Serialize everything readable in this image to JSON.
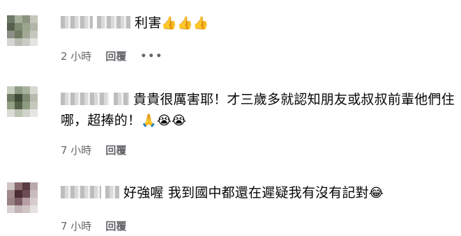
{
  "comments": [
    {
      "text": "利害",
      "emojis": "👍👍👍",
      "time": "2 小時",
      "reply": "回覆",
      "more": "•••",
      "avatar_colors": [
        "#6d7a66",
        "#a7b09c",
        "#8a9480",
        "#c6c6bc",
        "#56604f",
        "#7e8b72",
        "#9aa58c",
        "#b2b6a8",
        "#8b8f86",
        "#6f7b63",
        "#a2a896",
        "#c4c7bd",
        "#d5d6d1",
        "#b9bdb3",
        "#c9cbc4",
        "#e3e3df"
      ]
    },
    {
      "text": "貴貴很厲害耶！才三歲多就認知朋友或叔叔前輩他們住哪，超捧的！",
      "emojis": "🙏😭😭",
      "time": "7 小時",
      "reply": "回覆",
      "avatar_colors": [
        "#c7cfc0",
        "#8f9c83",
        "#a8b19c",
        "#d6d8d0",
        "#6e7a63",
        "#3f4b36",
        "#7d8a70",
        "#b8bcae",
        "#93a082",
        "#556248",
        "#8e9b80",
        "#c5c8bd",
        "#d9dbd5",
        "#bcc2b2",
        "#cfd2c9",
        "#e6e7e3"
      ]
    },
    {
      "text": "好強喔 我到國中都還在遲疑我有沒有記對",
      "emojis": "😂",
      "time": "7 小時",
      "reply": "回覆",
      "avatar_colors": [
        "#d0c6c6",
        "#8a6a6e",
        "#5c3c44",
        "#b9a9aa",
        "#a28a8c",
        "#4a2c34",
        "#6e4c54",
        "#c9bcbc",
        "#9a8284",
        "#7a5c62",
        "#b69ea2",
        "#d7cccc",
        "#d9d2d2",
        "#c3b4b6",
        "#cfc3c4",
        "#e6e1e1"
      ]
    }
  ]
}
